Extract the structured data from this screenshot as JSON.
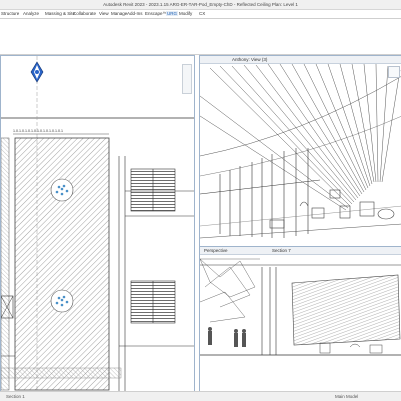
{
  "app": {
    "title": "Autodesk Revit 2023 - 2023.1.15 ARG-ER-TAR-Pod_Empty-ChD - Reflected Ceiling Plan: Level 1"
  },
  "menu": {
    "tabs": [
      "Structure",
      "Analyze",
      "Massing & Site",
      "Collaborate",
      "View",
      "Manage",
      "Add-Ins",
      "Enscape™",
      "URG",
      "Modify",
      "CX"
    ],
    "active": "URG"
  },
  "views": {
    "ceiling_plan": {
      "dimension_string": "1.0.1.0.1.0.1.0.1.0.1.0.1.0.1.0.1"
    },
    "view_3d": {
      "title": "Anthony: View (3)"
    },
    "section": {
      "title": "Section 7",
      "tab_label": "Perspective"
    }
  },
  "status": {
    "left_label": "Section 1",
    "right_label": "Main Model"
  },
  "colors": {
    "accent": "#1a5fb4",
    "view_border": "#9fb4cc",
    "ribbon_bg": "#ffffff",
    "hatch": "#8a8a8a",
    "light_fixture": "#4a90c8"
  },
  "icons": {
    "view_cube": "view-cube-icon",
    "navigation": "navigation-bar-icon",
    "north_arrow": "north-arrow-icon"
  }
}
